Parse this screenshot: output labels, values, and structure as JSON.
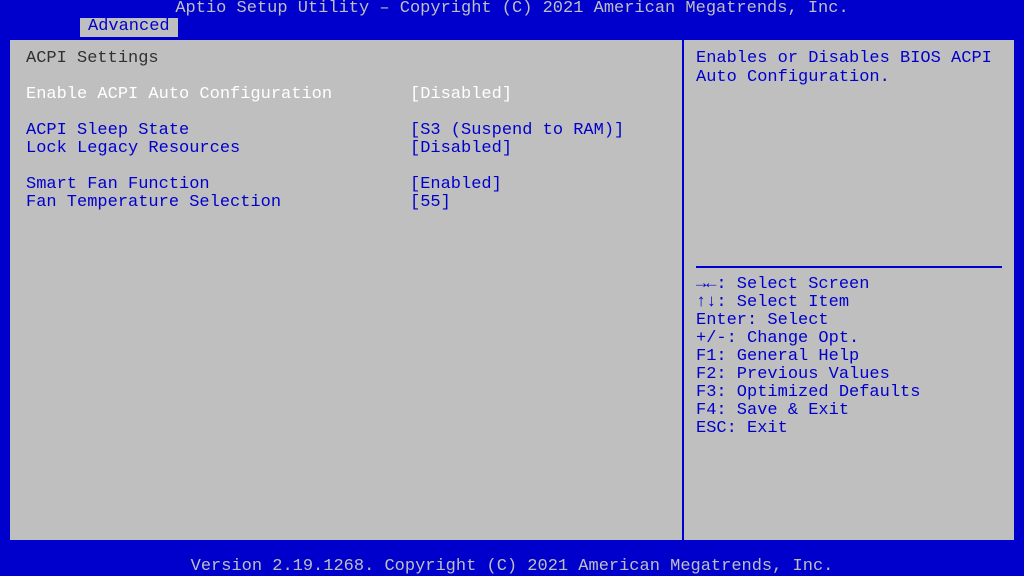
{
  "header": {
    "title": "Aptio Setup Utility – Copyright (C) 2021 American Megatrends, Inc."
  },
  "tabs": {
    "active": "Advanced"
  },
  "main": {
    "heading": "ACPI Settings",
    "items": [
      {
        "label": "Enable ACPI Auto Configuration",
        "value": "[Disabled]",
        "selected": true
      },
      {
        "label": "ACPI Sleep State",
        "value": "[S3 (Suspend to RAM)]",
        "selected": false,
        "gap_before": true
      },
      {
        "label": "Lock Legacy Resources",
        "value": "[Disabled]",
        "selected": false
      },
      {
        "label": "Smart Fan Function",
        "value": "[Enabled]",
        "selected": false,
        "gap_before": true
      },
      {
        "label": "Fan Temperature Selection",
        "value": "[55]",
        "selected": false
      }
    ]
  },
  "help": {
    "line1": "Enables or Disables BIOS ACPI",
    "line2": "Auto Configuration."
  },
  "hotkeys": {
    "h0": "→←: Select Screen",
    "h1": "↑↓: Select Item",
    "h2": "Enter: Select",
    "h3": "+/-: Change Opt.",
    "h4": "F1: General Help",
    "h5": "F2: Previous Values",
    "h6": "F3: Optimized Defaults",
    "h7": "F4: Save & Exit",
    "h8": "ESC: Exit"
  },
  "footer": {
    "text": "Version 2.19.1268. Copyright (C) 2021 American Megatrends, Inc."
  }
}
